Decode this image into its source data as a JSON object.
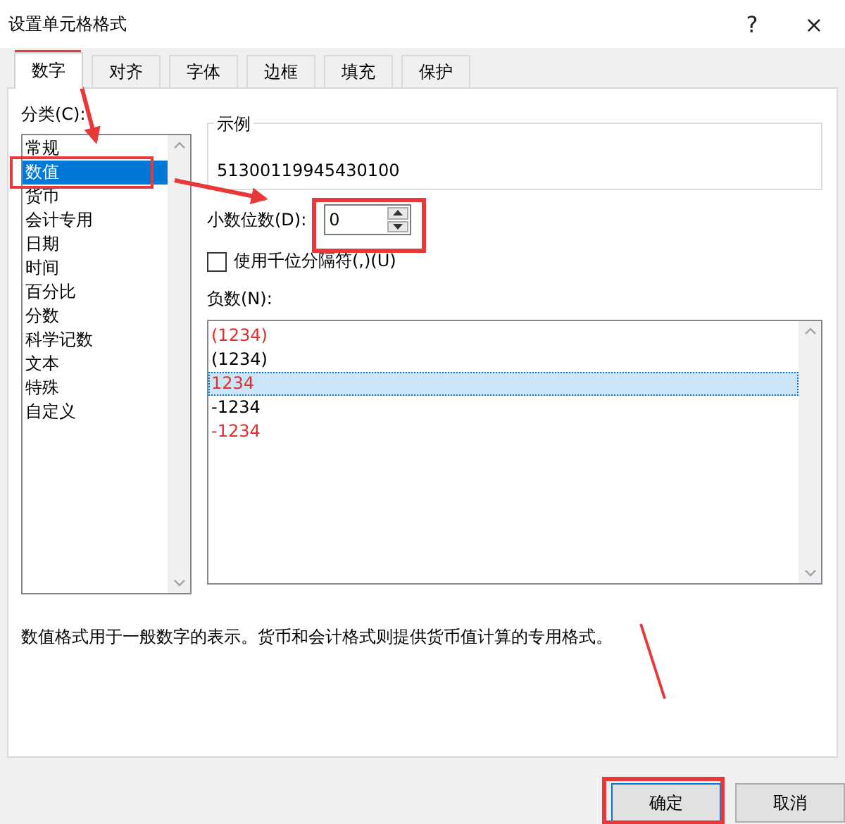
{
  "window": {
    "title": "设置单元格格式",
    "help": "?",
    "close": "×"
  },
  "tabs": [
    {
      "label": "数字",
      "selected": true
    },
    {
      "label": "对齐",
      "selected": false
    },
    {
      "label": "字体",
      "selected": false
    },
    {
      "label": "边框",
      "selected": false
    },
    {
      "label": "填充",
      "selected": false
    },
    {
      "label": "保护",
      "selected": false
    }
  ],
  "category": {
    "label": "分类(C):",
    "items": [
      {
        "label": "常规",
        "selected": false
      },
      {
        "label": "数值",
        "selected": true
      },
      {
        "label": "货币",
        "selected": false
      },
      {
        "label": "会计专用",
        "selected": false
      },
      {
        "label": "日期",
        "selected": false
      },
      {
        "label": "时间",
        "selected": false
      },
      {
        "label": "百分比",
        "selected": false
      },
      {
        "label": "分数",
        "selected": false
      },
      {
        "label": "科学记数",
        "selected": false
      },
      {
        "label": "文本",
        "selected": false
      },
      {
        "label": "特殊",
        "selected": false
      },
      {
        "label": "自定义",
        "selected": false
      }
    ]
  },
  "sample": {
    "label": "示例",
    "value": "51300119945430100"
  },
  "decimal_places": {
    "label": "小数位数(D):",
    "value": "0"
  },
  "thousands_separator": {
    "label": "使用千位分隔符(,)(U)",
    "checked": false
  },
  "negative_numbers": {
    "label": "负数(N):",
    "items": [
      {
        "label": "(1234)",
        "color": "#e03030",
        "selected": false
      },
      {
        "label": "(1234)",
        "color": "#000000",
        "selected": false
      },
      {
        "label": "1234",
        "color": "#e03030",
        "selected": true
      },
      {
        "label": "-1234",
        "color": "#000000",
        "selected": false
      },
      {
        "label": "-1234",
        "color": "#e03030",
        "selected": false
      }
    ]
  },
  "description": "数值格式用于一般数字的表示。货币和会计格式则提供货币值计算的专用格式。",
  "buttons": [
    {
      "label": "确定"
    },
    {
      "label": "取消"
    }
  ]
}
